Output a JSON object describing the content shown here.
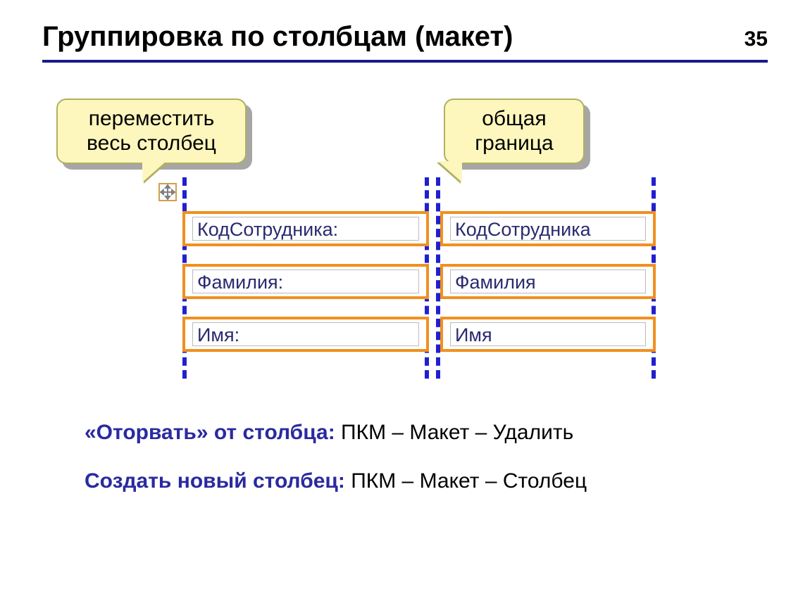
{
  "page_number": "35",
  "title": "Группировка по столбцам (макет)",
  "callouts": {
    "move_column": "переместить\nвесь столбец",
    "common_border": "общая\nграница"
  },
  "grid_rows": [
    {
      "label": "КодСотрудника:",
      "value": "КодСотрудника"
    },
    {
      "label": "Фамилия:",
      "value": "Фамилия"
    },
    {
      "label": "Имя:",
      "value": "Имя"
    }
  ],
  "notes": {
    "detach_label": "«Оторвать» от столбца:",
    "detach_value": " ПКМ – Макет – Удалить",
    "newcol_label": "Создать новый столбец:",
    "newcol_value": " ПКМ – Макет – Столбец"
  }
}
